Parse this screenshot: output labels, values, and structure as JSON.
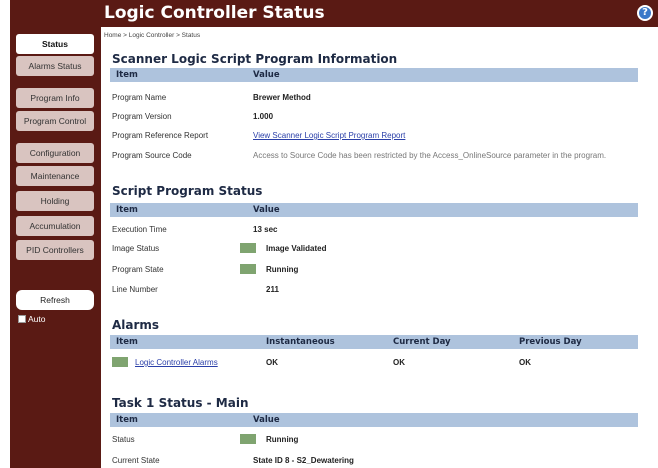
{
  "header": {
    "title": "Logic Controller Status"
  },
  "sidebar": {
    "items": [
      {
        "label": "Status"
      },
      {
        "label": "Alarms Status"
      },
      {
        "label": "Program Info"
      },
      {
        "label": "Program Control"
      },
      {
        "label": "Configuration"
      },
      {
        "label": "Maintenance"
      },
      {
        "label": "Holding"
      },
      {
        "label": "Accumulation"
      },
      {
        "label": "PID Controllers"
      }
    ],
    "refresh_label": "Refresh",
    "auto_label": "Auto"
  },
  "breadcrumb": "Home > Logic Controller > Status",
  "info": {
    "title": "Scanner Logic Script Program Information",
    "col_item": "Item",
    "col_value": "Value",
    "rows": [
      {
        "item": "Program Name",
        "value": "Brewer Method"
      },
      {
        "item": "Program Version",
        "value": "1.000"
      },
      {
        "item": "Program Reference Report",
        "value": "View Scanner Logic Script Program Report"
      },
      {
        "item": "Program Source Code",
        "value": "Access to Source Code has been restricted by the Access_OnlineSource parameter in the program."
      }
    ]
  },
  "script": {
    "title": "Script Program Status",
    "col_item": "Item",
    "col_value": "Value",
    "rows": [
      {
        "item": "Execution Time",
        "value": "13 sec"
      },
      {
        "item": "Image Status",
        "value": "Image Validated"
      },
      {
        "item": "Program State",
        "value": "Running"
      },
      {
        "item": "Line Number",
        "value": "211"
      }
    ]
  },
  "alarms": {
    "title": "Alarms",
    "cols": [
      "Item",
      "Instantaneous",
      "Current Day",
      "Previous Day"
    ],
    "row": {
      "item": "Logic Controller Alarms",
      "instantaneous": "OK",
      "current_day": "OK",
      "previous_day": "OK"
    }
  },
  "task": {
    "title": "Task 1 Status - Main",
    "col_item": "Item",
    "col_value": "Value",
    "rows": [
      {
        "item": "Status",
        "value": "Running"
      },
      {
        "item": "Current State",
        "value": "State ID 8 - S2_Dewatering"
      }
    ]
  },
  "colors": {
    "brand": "#5a1a14",
    "table_header": "#aec3dd",
    "status_ok": "#7fa470"
  }
}
